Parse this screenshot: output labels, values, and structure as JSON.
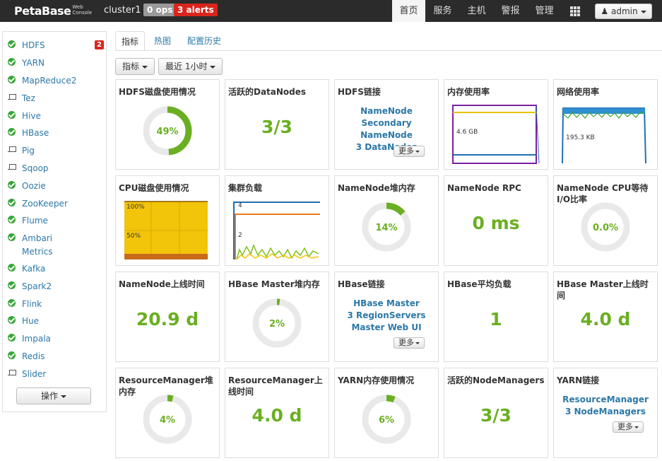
{
  "header": {
    "brand": "PetaBase",
    "brand_sub1": "Web",
    "brand_sub2": "Console",
    "cluster": "cluster1",
    "ops": "0 ops",
    "alerts": "3 alerts",
    "nav": [
      "首页",
      "服务",
      "主机",
      "警报",
      "管理"
    ],
    "user": "admin"
  },
  "sidebar": {
    "services": [
      {
        "label": "HDFS",
        "status": "ok",
        "badge": "2"
      },
      {
        "label": "YARN",
        "status": "ok"
      },
      {
        "label": "MapReduce2",
        "status": "ok"
      },
      {
        "label": "Tez",
        "status": "client"
      },
      {
        "label": "Hive",
        "status": "ok"
      },
      {
        "label": "HBase",
        "status": "ok"
      },
      {
        "label": "Pig",
        "status": "client"
      },
      {
        "label": "Sqoop",
        "status": "client"
      },
      {
        "label": "Oozie",
        "status": "ok"
      },
      {
        "label": "ZooKeeper",
        "status": "ok"
      },
      {
        "label": "Flume",
        "status": "ok"
      },
      {
        "label": "Ambari",
        "label2": "Metrics",
        "status": "ok"
      },
      {
        "label": "Kafka",
        "status": "ok"
      },
      {
        "label": "Spark2",
        "status": "ok"
      },
      {
        "label": "Flink",
        "status": "ok"
      },
      {
        "label": "Hue",
        "status": "ok"
      },
      {
        "label": "Impala",
        "status": "ok"
      },
      {
        "label": "Redis",
        "status": "ok"
      },
      {
        "label": "Slider",
        "status": "client"
      }
    ],
    "actions": "操作"
  },
  "tabs": [
    "指标",
    "热图",
    "配置历史"
  ],
  "toolbar": {
    "metrics": "指标",
    "range": "最近 1小时"
  },
  "widgets": {
    "hdfs_disk": {
      "title": "HDFS磁盘使用情况",
      "value": "49%",
      "fraction": 0.49
    },
    "datanodes": {
      "title": "活跃的DataNodes",
      "value": "3/3"
    },
    "hdfs_links": {
      "title": "HDFS链接",
      "links": [
        "NameNode",
        "Secondary NameNode",
        "3 DataNodes"
      ],
      "more": "更多"
    },
    "mem": {
      "title": "内存使用率",
      "label": "4.6 GB"
    },
    "net": {
      "title": "网络使用率",
      "label": "195.3 KB"
    },
    "cpu": {
      "title": "CPU磁盘使用情况",
      "label_top": "100%",
      "label_mid": "50%"
    },
    "cluster_load": {
      "title": "集群负载",
      "label_top": "4",
      "label_mid": "2"
    },
    "nn_heap": {
      "title": "NameNode堆内存",
      "value": "14%",
      "fraction": 0.14
    },
    "nn_rpc": {
      "title": "NameNode RPC",
      "value": "0 ms"
    },
    "nn_cpu": {
      "title": "NameNode CPU等待I/O比率",
      "value": "0.0%",
      "fraction": 0.0
    },
    "nn_uptime": {
      "title": "NameNode上线时间",
      "value": "20.9 d"
    },
    "hbm_heap": {
      "title": "HBase Master堆内存",
      "value": "2%",
      "fraction": 0.02
    },
    "hbase_links": {
      "title": "HBase链接",
      "links": [
        "HBase Master",
        "3 RegionServers",
        "Master Web UI"
      ],
      "more": "更多"
    },
    "hbase_load": {
      "title": "HBase平均负载",
      "value": "1"
    },
    "hbm_uptime": {
      "title": "HBase Master上线时间",
      "value": "4.0 d"
    },
    "rm_heap": {
      "title": "ResourceManager堆内存",
      "value": "4%",
      "fraction": 0.04
    },
    "rm_uptime": {
      "title": "ResourceManager上线时间",
      "value": "4.0 d"
    },
    "yarn_mem": {
      "title": "YARN内存使用情况",
      "value": "6%",
      "fraction": 0.06
    },
    "nodemanagers": {
      "title": "活跃的NodeManagers",
      "value": "3/3"
    },
    "yarn_links": {
      "title": "YARN链接",
      "links": [
        "ResourceManager",
        "3 NodeManagers"
      ],
      "more": "更多"
    }
  },
  "colors": {
    "accent_green": "#6aaf22",
    "link_blue": "#2b78a8",
    "alert_red": "#d9251c",
    "nav_dark": "#2b2b2b"
  }
}
